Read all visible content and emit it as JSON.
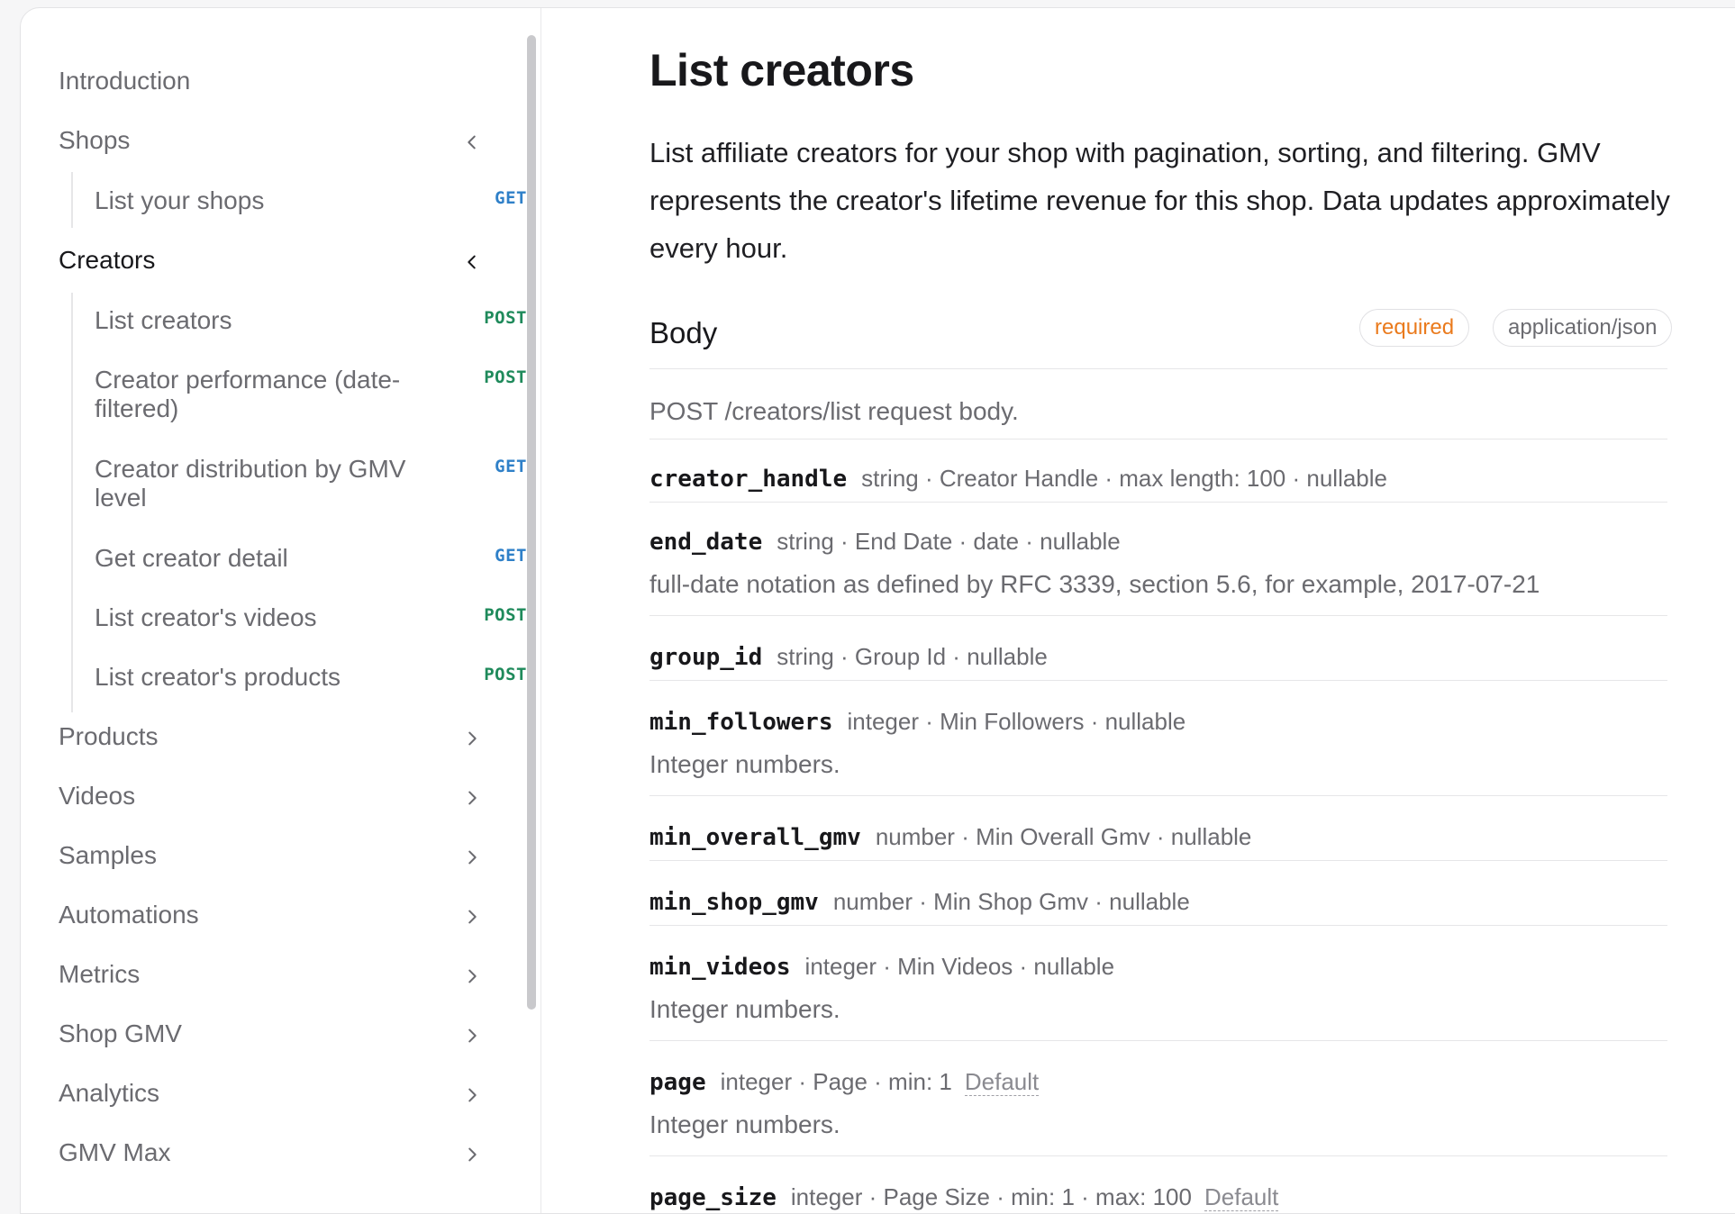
{
  "sidebar": {
    "items": [
      {
        "label": "Introduction"
      },
      {
        "label": "Shops",
        "chevron": "left"
      },
      {
        "label": "Creators",
        "chevron": "left"
      },
      {
        "label": "Products",
        "chevron": "right"
      },
      {
        "label": "Videos",
        "chevron": "right"
      },
      {
        "label": "Samples",
        "chevron": "right"
      },
      {
        "label": "Automations",
        "chevron": "right"
      },
      {
        "label": "Metrics",
        "chevron": "right"
      },
      {
        "label": "Shop GMV",
        "chevron": "right"
      },
      {
        "label": "Analytics",
        "chevron": "right"
      },
      {
        "label": "GMV Max",
        "chevron": "right"
      }
    ],
    "shops_children": [
      {
        "label": "List your shops",
        "method": "GET"
      }
    ],
    "creators_children": [
      {
        "label": "List creators",
        "method": "POST"
      },
      {
        "label": "Creator performance (date-filtered)",
        "method": "POST"
      },
      {
        "label": "Creator distribution by GMV level",
        "method": "GET"
      },
      {
        "label": "Get creator detail",
        "method": "GET"
      },
      {
        "label": "List creator's videos",
        "method": "POST"
      },
      {
        "label": "List creator's products",
        "method": "POST"
      }
    ]
  },
  "main": {
    "title": "List creators",
    "intro": "List affiliate creators for your shop with pagination, sorting, and filtering. GMV represents the creator's lifetime revenue for this shop. Data updates approximately every hour.",
    "body_heading": "Body",
    "required_label": "required",
    "content_type": "application/json",
    "body_description": "POST /creators/list request body.",
    "fields": [
      {
        "name": "creator_handle",
        "meta": "string · Creator Handle · max length:  100 · nullable"
      },
      {
        "name": "end_date",
        "meta": "string · End Date · date · nullable",
        "desc": "full-date notation as defined by RFC 3339, section 5.6, for example, 2017-07-21"
      },
      {
        "name": "group_id",
        "meta": "string · Group Id · nullable"
      },
      {
        "name": "min_followers",
        "meta": "integer · Min Followers · nullable",
        "desc": "Integer numbers."
      },
      {
        "name": "min_overall_gmv",
        "meta": "number · Min Overall Gmv · nullable"
      },
      {
        "name": "min_shop_gmv",
        "meta": "number · Min Shop Gmv · nullable"
      },
      {
        "name": "min_videos",
        "meta": "integer · Min Videos · nullable",
        "desc": "Integer numbers."
      },
      {
        "name": "page",
        "meta": "integer · Page · min:  1",
        "default": "Default",
        "desc": "Integer numbers."
      },
      {
        "name": "page_size",
        "meta": "integer · Page Size · min:  1 · max:  100",
        "default": "Default"
      }
    ]
  },
  "colors": {
    "get": "#2f80c8",
    "post": "#1f8a5b",
    "required": "#ea7a1c"
  }
}
